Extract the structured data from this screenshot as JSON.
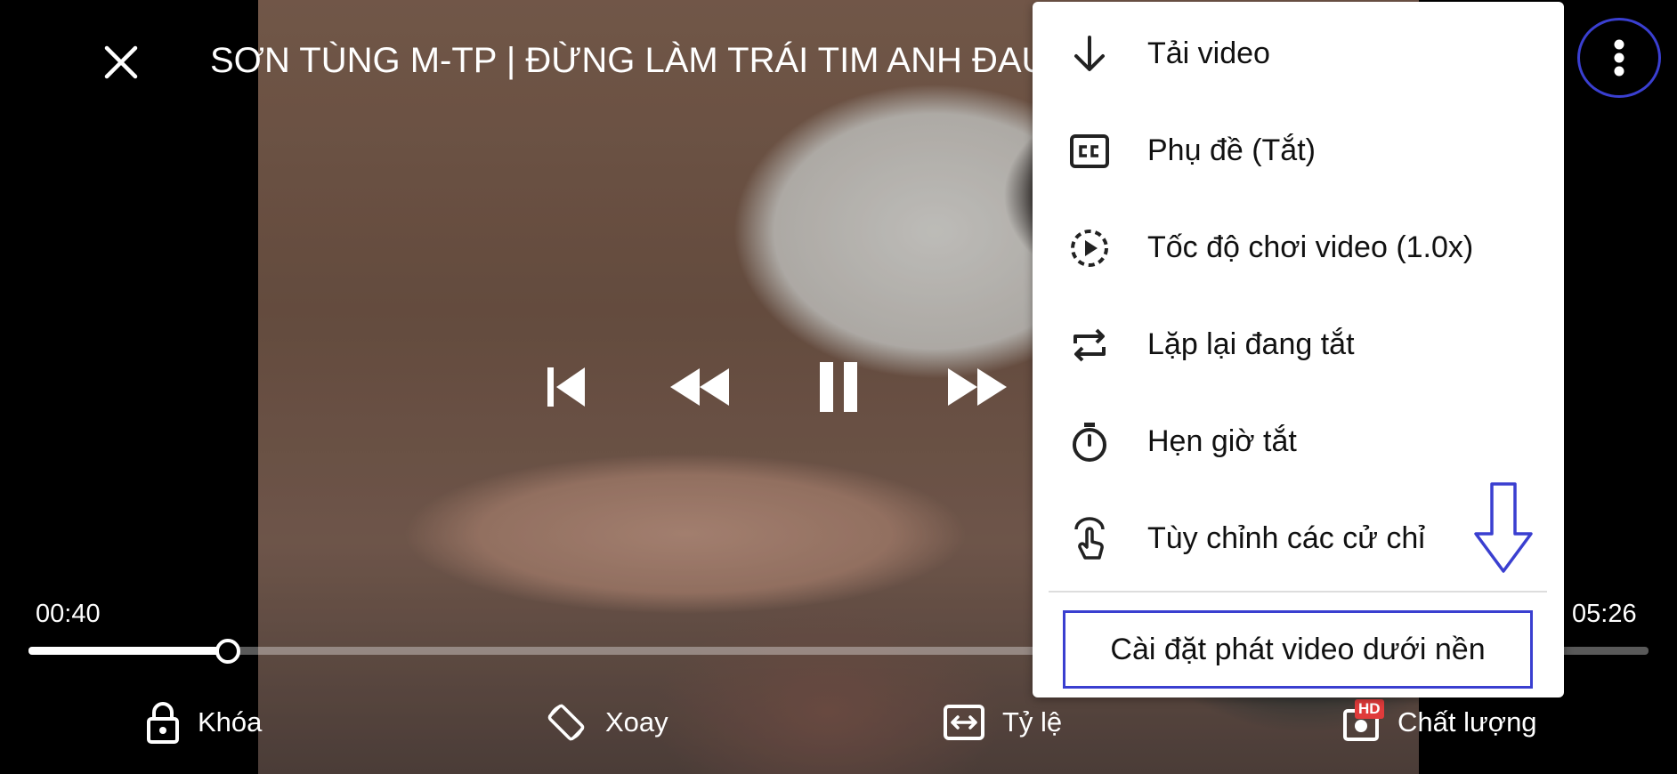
{
  "player": {
    "title": "SƠN TÙNG M-TP | ĐỪNG LÀM TRÁI TIM ANH ĐAU",
    "current_time": "00:40",
    "duration": "05:26",
    "progress": 0.123,
    "icons": {
      "close": "close-icon",
      "more": "more-vertical-icon",
      "skip_previous": "skip-previous-icon",
      "rewind": "rewind-icon",
      "pause": "pause-icon",
      "fast_forward": "fast-forward-icon"
    },
    "bottom_bar": {
      "lock": "Khóa",
      "rotate": "Xoay",
      "ratio": "Tỷ lệ",
      "quality": "Chất lượng",
      "quality_badge": "HD"
    }
  },
  "menu": {
    "items": [
      {
        "label": "Tải video",
        "icon": "download-icon"
      },
      {
        "label": "Phụ đề (Tắt)",
        "icon": "closed-caption-icon"
      },
      {
        "label": "Tốc độ chơi video (1.0x)",
        "icon": "playback-speed-icon"
      },
      {
        "label": "Lặp lại đang tắt",
        "icon": "repeat-icon"
      },
      {
        "label": "Hẹn giờ tắt",
        "icon": "timer-icon"
      },
      {
        "label": "Tùy chỉnh các cử chỉ",
        "icon": "gesture-icon"
      }
    ],
    "background_setting": "Cài đặt phát video dưới nền"
  },
  "colors": {
    "highlight": "#3a3fd0",
    "badge": "#e03b3b"
  }
}
